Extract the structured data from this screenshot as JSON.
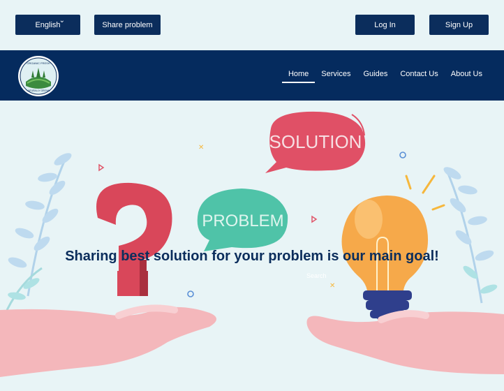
{
  "topbar": {
    "language_label": "English",
    "share_label": "Share problem",
    "login_label": "Log In",
    "signup_label": "Sign Up"
  },
  "logo": {
    "top_text": "ORGANIC FRESH",
    "bottom_text": "NATURALLY GROWN"
  },
  "nav": {
    "items": [
      {
        "label": "Home",
        "active": true
      },
      {
        "label": "Services"
      },
      {
        "label": "Guides"
      },
      {
        "label": "Contact Us"
      },
      {
        "label": "About Us"
      }
    ]
  },
  "hero": {
    "headline": "Sharing best solution for your problem is our main goal!",
    "search_label": "Search",
    "solution_bubble": "SOLUTION",
    "problem_bubble": "PROBLEM"
  },
  "colors": {
    "navy": "#052b5e",
    "background": "#e8f4f6",
    "question_red": "#d9475a",
    "problem_green": "#4fc3a8",
    "bulb_yellow": "#f6a94a"
  }
}
